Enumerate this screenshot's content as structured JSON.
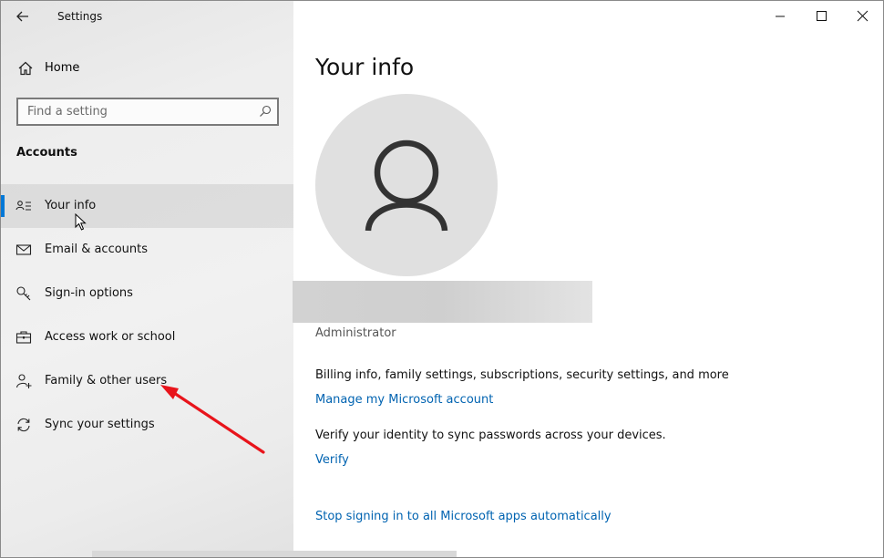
{
  "window": {
    "title": "Settings",
    "controls": {
      "minimize_icon": "minimize-icon",
      "maximize_icon": "maximize-icon",
      "close_icon": "close-icon"
    }
  },
  "sidebar": {
    "back_icon": "back-arrow-icon",
    "home": {
      "label": "Home",
      "icon": "home-icon"
    },
    "search": {
      "placeholder": "Find a setting",
      "icon": "search-icon"
    },
    "section_title": "Accounts",
    "items": [
      {
        "label": "Your info",
        "icon": "contact-card-icon",
        "selected": true
      },
      {
        "label": "Email & accounts",
        "icon": "mail-icon",
        "selected": false
      },
      {
        "label": "Sign-in options",
        "icon": "key-icon",
        "selected": false
      },
      {
        "label": "Access work or school",
        "icon": "briefcase-icon",
        "selected": false
      },
      {
        "label": "Family & other users",
        "icon": "add-person-icon",
        "selected": false
      },
      {
        "label": "Sync your settings",
        "icon": "sync-icon",
        "selected": false
      }
    ],
    "accent_color": "#0078d7"
  },
  "main": {
    "title": "Your info",
    "avatar_icon": "user-avatar-icon",
    "role": "Administrator",
    "billing_text": "Billing info, family settings, subscriptions, security settings, and more",
    "manage_link": "Manage my Microsoft account",
    "verify_text": "Verify your identity to sync passwords across your devices.",
    "verify_link": "Verify",
    "stop_link": "Stop signing in to all Microsoft apps automatically",
    "link_color": "#0063b1"
  },
  "annotation": {
    "arrow_color": "#e8141b",
    "target": "Family & other users"
  }
}
